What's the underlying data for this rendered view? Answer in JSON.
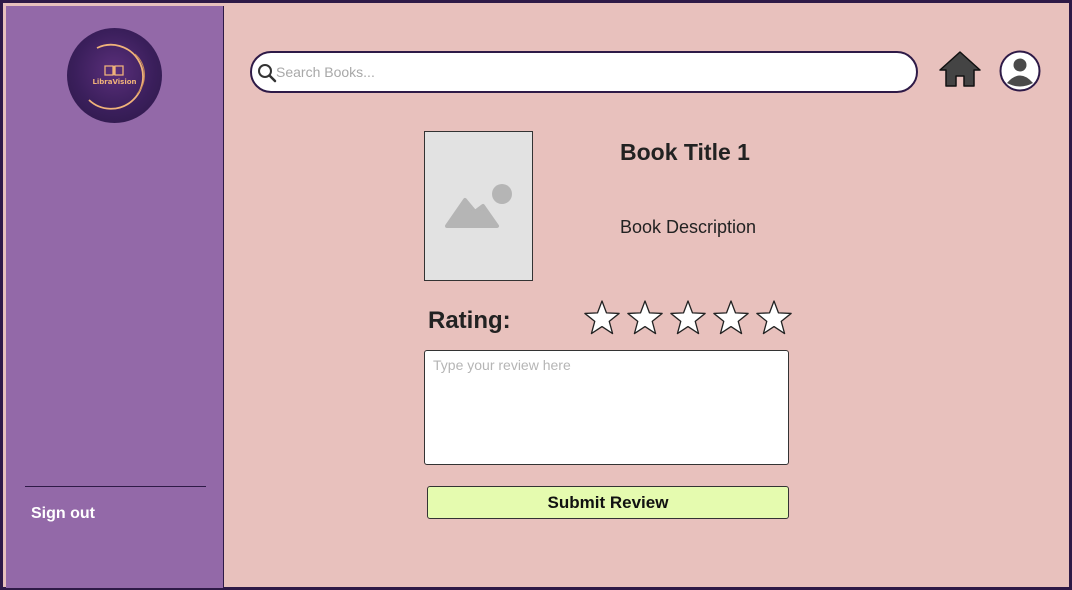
{
  "sidebar": {
    "logo_text": "LibraVision",
    "signout_label": "Sign out"
  },
  "search": {
    "placeholder": "Search Books...",
    "value": ""
  },
  "header": {
    "home_icon": "home-icon",
    "profile_icon": "user-profile-icon"
  },
  "book": {
    "title": "Book Title 1",
    "description": "Book Description",
    "cover_icon": "image-placeholder-icon"
  },
  "rating": {
    "label": "Rating:",
    "max": 5,
    "value": 0
  },
  "review": {
    "placeholder": "Type your review here",
    "value": ""
  },
  "submit_label": "Submit Review",
  "colors": {
    "sidebar": "#9369a8",
    "background": "#e8c1bd",
    "border": "#2e1a47",
    "submit": "#e5fbaf",
    "logo_accent": "#f0b37a"
  }
}
